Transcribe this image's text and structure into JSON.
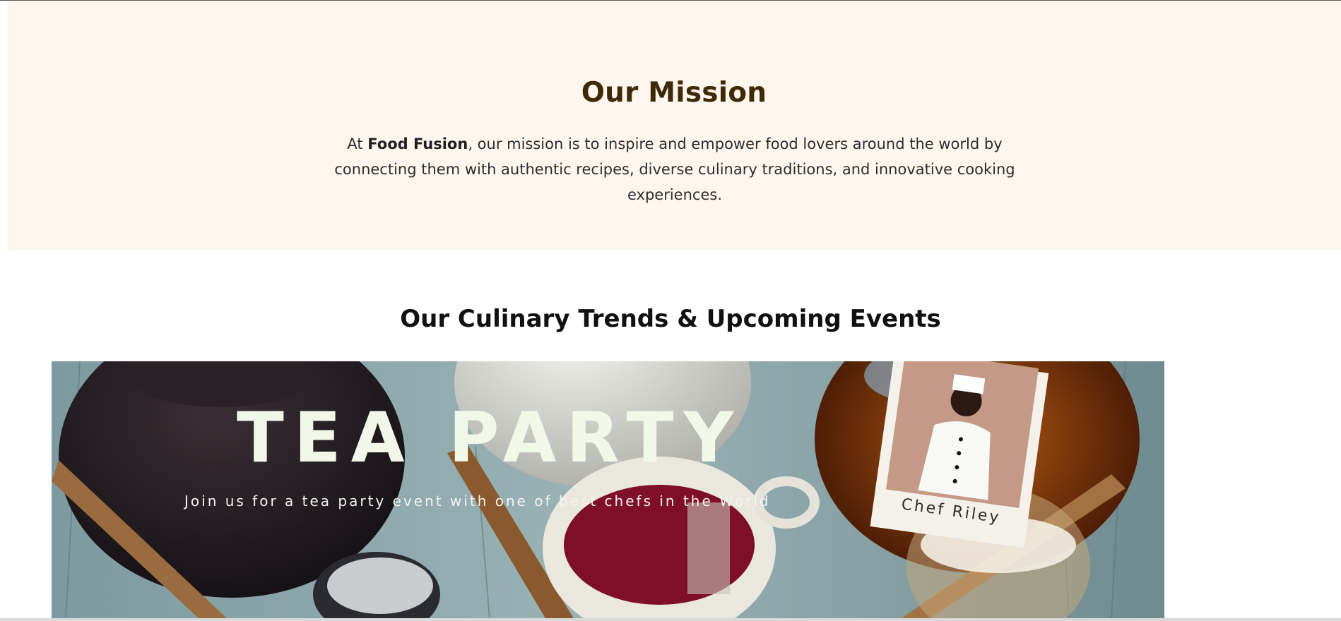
{
  "mission": {
    "title": "Our Mission",
    "text_prefix": "At ",
    "brand": "Food Fusion",
    "text_rest": ", our mission is to inspire and empower food lovers around the world by connecting them with authentic recipes, diverse culinary traditions, and innovative cooking experiences."
  },
  "events": {
    "title": "Our Culinary Trends & Upcoming Events"
  },
  "banner": {
    "headline": "TEA PARTY",
    "subline": "Join us for a tea party event with one of best chefs in the World",
    "chef_caption": "Chef Riley"
  },
  "colors": {
    "mission_bg": "#fff6f0",
    "mission_title": "#3f2a08"
  }
}
